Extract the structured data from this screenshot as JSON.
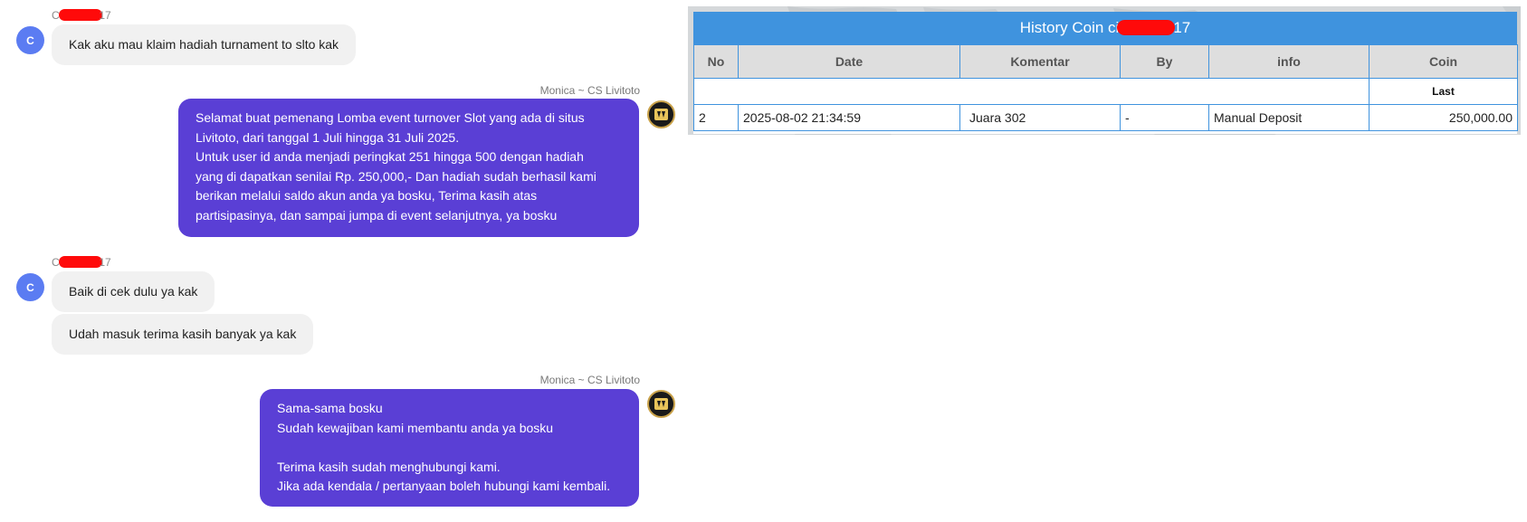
{
  "chat": {
    "customer": {
      "name_prefix": "Ci",
      "name_suffix": "17",
      "avatar_letter": "C"
    },
    "agent": {
      "name": "Monica ~ CS Livitoto"
    },
    "messages": {
      "m1": "Kak aku mau klaim hadiah turnament to slto kak",
      "m2": [
        "Selamat buat pemenang Lomba event turnover Slot yang ada di situs",
        "Livitoto, dari tanggal 1 Juli hingga 31 Juli 2025.",
        "Untuk user id anda menjadi peringkat 251 hingga 500 dengan hadiah",
        "yang di dapatkan senilai Rp. 250,000,- Dan hadiah sudah berhasil kami",
        "berikan melalui saldo akun anda ya bosku, Terima kasih atas",
        "partisipasinya, dan sampai jumpa di event selanjutnya, ya bosku"
      ],
      "m3": "Baik di cek dulu ya kak",
      "m4": "Udah masuk terima kasih banyak ya kak",
      "m5": [
        "Sama-sama bosku",
        "Sudah kewajiban kami membantu anda ya bosku",
        "",
        "Terima kasih sudah menghubungi kami.",
        "Jika ada kendala / pertanyaan boleh hubungi kami kembali."
      ]
    }
  },
  "history": {
    "title_prefix": "History Coin ci",
    "title_suffix": "17",
    "headers": [
      "No",
      "Date",
      "Komentar",
      "By",
      "info",
      "Coin"
    ],
    "last_label": "Last",
    "row": {
      "no": "2",
      "date": "2025-08-02 21:34:59",
      "komentar": "Juara 302",
      "by": "-",
      "info": "Manual Deposit",
      "coin": "250,000.00"
    }
  },
  "colors": {
    "agent_bubble": "#5a3fd5",
    "customer_bubble": "#f1f1f1",
    "customer_avatar": "#5b7cf2",
    "table_header_bar": "#3f93de",
    "coin_value": "#1c8a2a",
    "redaction": "#ff0a0a"
  },
  "icons": {
    "customer_avatar": "letter-avatar",
    "agent_avatar": "livitoto-logo"
  }
}
